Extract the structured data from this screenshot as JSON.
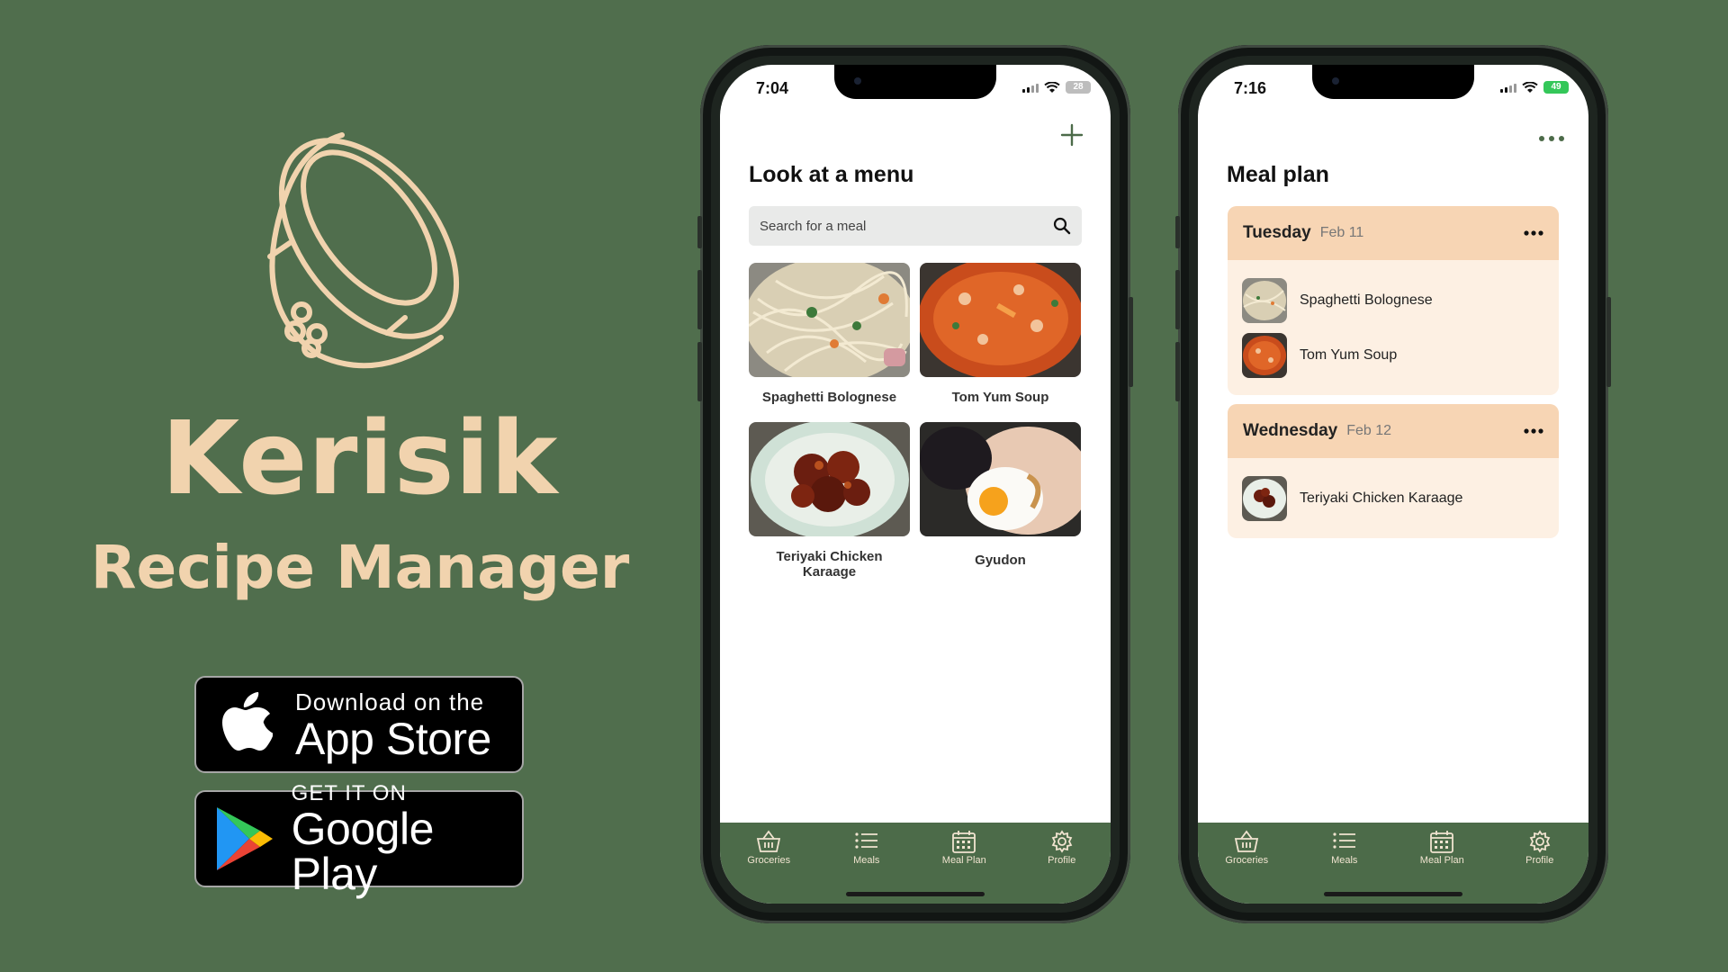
{
  "brand": {
    "name": "Kerisik",
    "subtitle": "Recipe Manager",
    "logo_color": "#f1d3ae",
    "background": "#506e4d"
  },
  "badges": {
    "appstore": {
      "small": "Download on the",
      "large": "App Store",
      "icon": "apple-icon"
    },
    "gplay": {
      "small": "GET IT ON",
      "large": "Google Play",
      "icon": "google-play-icon"
    }
  },
  "phone1": {
    "time": "7:04",
    "battery": "28",
    "add_icon": "plus-icon",
    "title": "Look at a menu",
    "search_placeholder": "Search for a meal",
    "meals": [
      {
        "name": "Spaghetti Bolognese"
      },
      {
        "name": "Tom Yum Soup"
      },
      {
        "name": "Teriyaki Chicken Karaage"
      },
      {
        "name": "Gyudon"
      }
    ]
  },
  "phone2": {
    "time": "7:16",
    "battery": "49",
    "more_icon": "more-icon",
    "title": "Meal plan",
    "days": [
      {
        "day": "Tuesday",
        "date": "Feb 11",
        "items": [
          "Spaghetti Bolognese",
          "Tom Yum Soup"
        ]
      },
      {
        "day": "Wednesday",
        "date": "Feb 12",
        "items": [
          "Teriyaki Chicken Karaage"
        ]
      }
    ]
  },
  "tabs": [
    {
      "label": "Groceries",
      "icon": "basket-icon"
    },
    {
      "label": "Meals",
      "icon": "list-icon"
    },
    {
      "label": "Meal Plan",
      "icon": "calendar-icon"
    },
    {
      "label": "Profile",
      "icon": "gear-icon"
    }
  ],
  "colors": {
    "tabbar": "#4c6b49",
    "day_header": "#f7d5b4",
    "day_body": "#fdf0e3",
    "accent_green": "#4c6b49"
  }
}
